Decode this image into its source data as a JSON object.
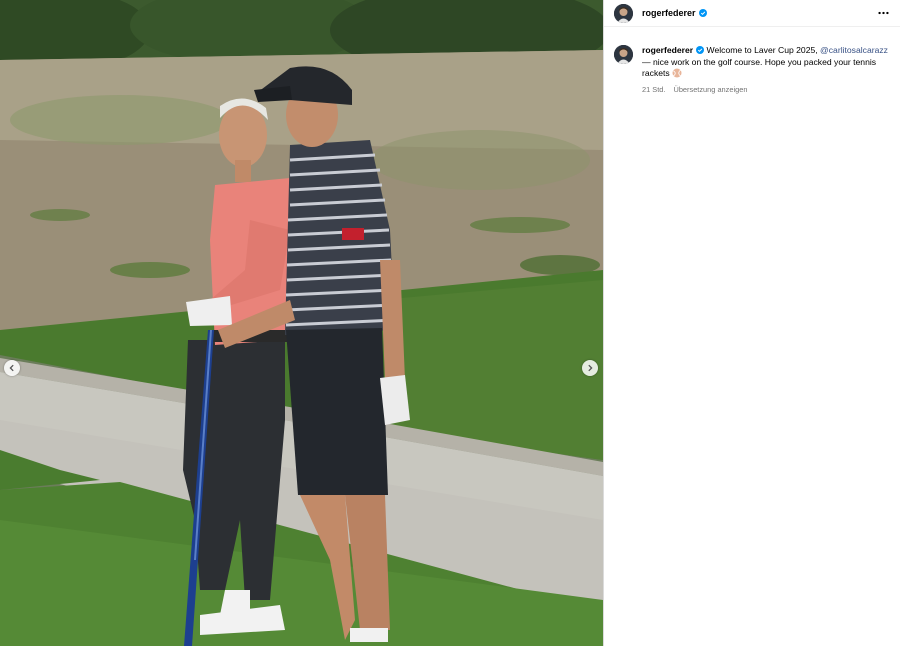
{
  "post": {
    "username": "rogerfederer",
    "verified": true,
    "more_icon": "more-options-icon"
  },
  "caption": {
    "username": "rogerfederer",
    "text_before": " Welcome to Laver Cup 2025, ",
    "mention": "@carlitosalcarazz",
    "text_after": " — nice work on the golf course. Hope you packed your tennis rackets ",
    "emoji": "🎾"
  },
  "meta": {
    "time": "21 Std.",
    "translate_label": "Übersetzung anzeigen"
  },
  "carousel": {
    "prev_icon": "chevron-left-icon",
    "next_icon": "chevron-right-icon"
  },
  "colors": {
    "link": "#385185",
    "verified": "#0095f6",
    "secondary_text": "#737373"
  }
}
